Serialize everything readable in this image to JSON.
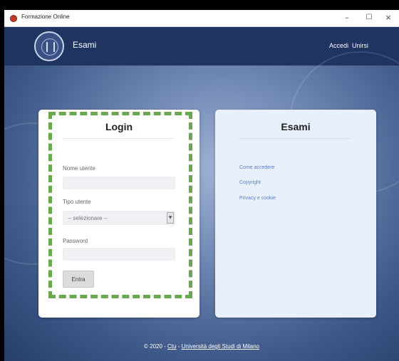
{
  "window": {
    "title": "Formazione Online",
    "minimize_glyph": "–",
    "maximize_glyph": "☐",
    "close_glyph": "×"
  },
  "header": {
    "title": "Esami",
    "nav": [
      "Accedi",
      "Unirsi"
    ]
  },
  "login": {
    "title": "Login",
    "username_label": "Nome utente",
    "username_value": "",
    "user_type_label": "Tipo utente",
    "user_type_selected": "-- selezionare --",
    "password_label": "Password",
    "password_value": "",
    "submit_label": "Entra"
  },
  "exams": {
    "title": "Esami",
    "links": [
      "Come accedere",
      "Copyright",
      "Privacy e cookie"
    ]
  },
  "footer": {
    "prefix": "© 2020 - ",
    "link_1": "Ctu",
    "separator": " - ",
    "link_2": "Università degli Studi di Milano"
  },
  "colors": {
    "header_bg": "#1f3460",
    "highlight_dash": "#6aa84f",
    "link": "#5b7fc0"
  },
  "icons": {
    "app": "app-icon",
    "logo": "university-seal-logo",
    "select": "chevron-down-icon"
  }
}
